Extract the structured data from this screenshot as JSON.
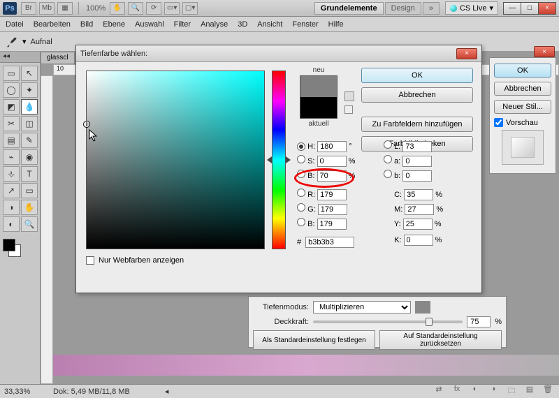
{
  "appbar": {
    "logo": "Ps",
    "small_btns": [
      "Br",
      "Mb"
    ],
    "zoom": "100%",
    "workspace": {
      "active": "Grundelemente",
      "inactive": "Design",
      "more": "»"
    },
    "cslive": "CS Live",
    "winctrl": {
      "min": "—",
      "max": "□",
      "close": "×"
    }
  },
  "menu": [
    "Datei",
    "Bearbeiten",
    "Bild",
    "Ebene",
    "Auswahl",
    "Filter",
    "Analyse",
    "3D",
    "Ansicht",
    "Fenster",
    "Hilfe"
  ],
  "optbar": {
    "label": "Aufnal"
  },
  "doc": {
    "tab": "glasscl",
    "ruler_start": "10"
  },
  "status": {
    "zoom": "33,33%",
    "dok": "Dok: 5,49 MB/11,8 MB"
  },
  "styledlg": {
    "mode_label": "Tiefenmodus:",
    "mode_value": "Multiplizieren",
    "opacity_label": "Deckkraft:",
    "opacity_value": "75",
    "opacity_unit": "%",
    "btn_default": "Als Standardeinstellung festlegen",
    "btn_reset": "Auf Standardeinstellung zurücksetzen"
  },
  "sidedlg": {
    "ok": "OK",
    "cancel": "Abbrechen",
    "newstyle": "Neuer Stil...",
    "preview_chk": "Vorschau"
  },
  "picker": {
    "title": "Tiefenfarbe wählen:",
    "neu": "neu",
    "aktuell": "aktuell",
    "ok": "OK",
    "cancel": "Abbrechen",
    "addswatch": "Zu Farbfeldern hinzufügen",
    "libs": "Farbbibliotheken",
    "webonly": "Nur Webfarben anzeigen",
    "H": {
      "lab": "H:",
      "val": "180",
      "unit": "°"
    },
    "S": {
      "lab": "S:",
      "val": "0",
      "unit": "%"
    },
    "B": {
      "lab": "B:",
      "val": "70",
      "unit": "%"
    },
    "R": {
      "lab": "R:",
      "val": "179"
    },
    "G": {
      "lab": "G:",
      "val": "179"
    },
    "Bl": {
      "lab": "B:",
      "val": "179"
    },
    "L": {
      "lab": "L:",
      "val": "73"
    },
    "a": {
      "lab": "a:",
      "val": "0"
    },
    "b": {
      "lab": "b:",
      "val": "0"
    },
    "C": {
      "lab": "C:",
      "val": "35",
      "unit": "%"
    },
    "M": {
      "lab": "M:",
      "val": "27",
      "unit": "%"
    },
    "Y": {
      "lab": "Y:",
      "val": "25",
      "unit": "%"
    },
    "K": {
      "lab": "K:",
      "val": "0",
      "unit": "%"
    },
    "hex_lab": "#",
    "hex": "b3b3b3"
  },
  "tools": [
    "▭",
    "↖",
    "◯",
    "✦",
    "◩",
    "💧",
    "✂",
    "◫",
    "▤",
    "✎",
    "⌁",
    "◉",
    "⎀",
    "T",
    "↗",
    "▭",
    "◑",
    "✋",
    "◐",
    "🔍"
  ]
}
